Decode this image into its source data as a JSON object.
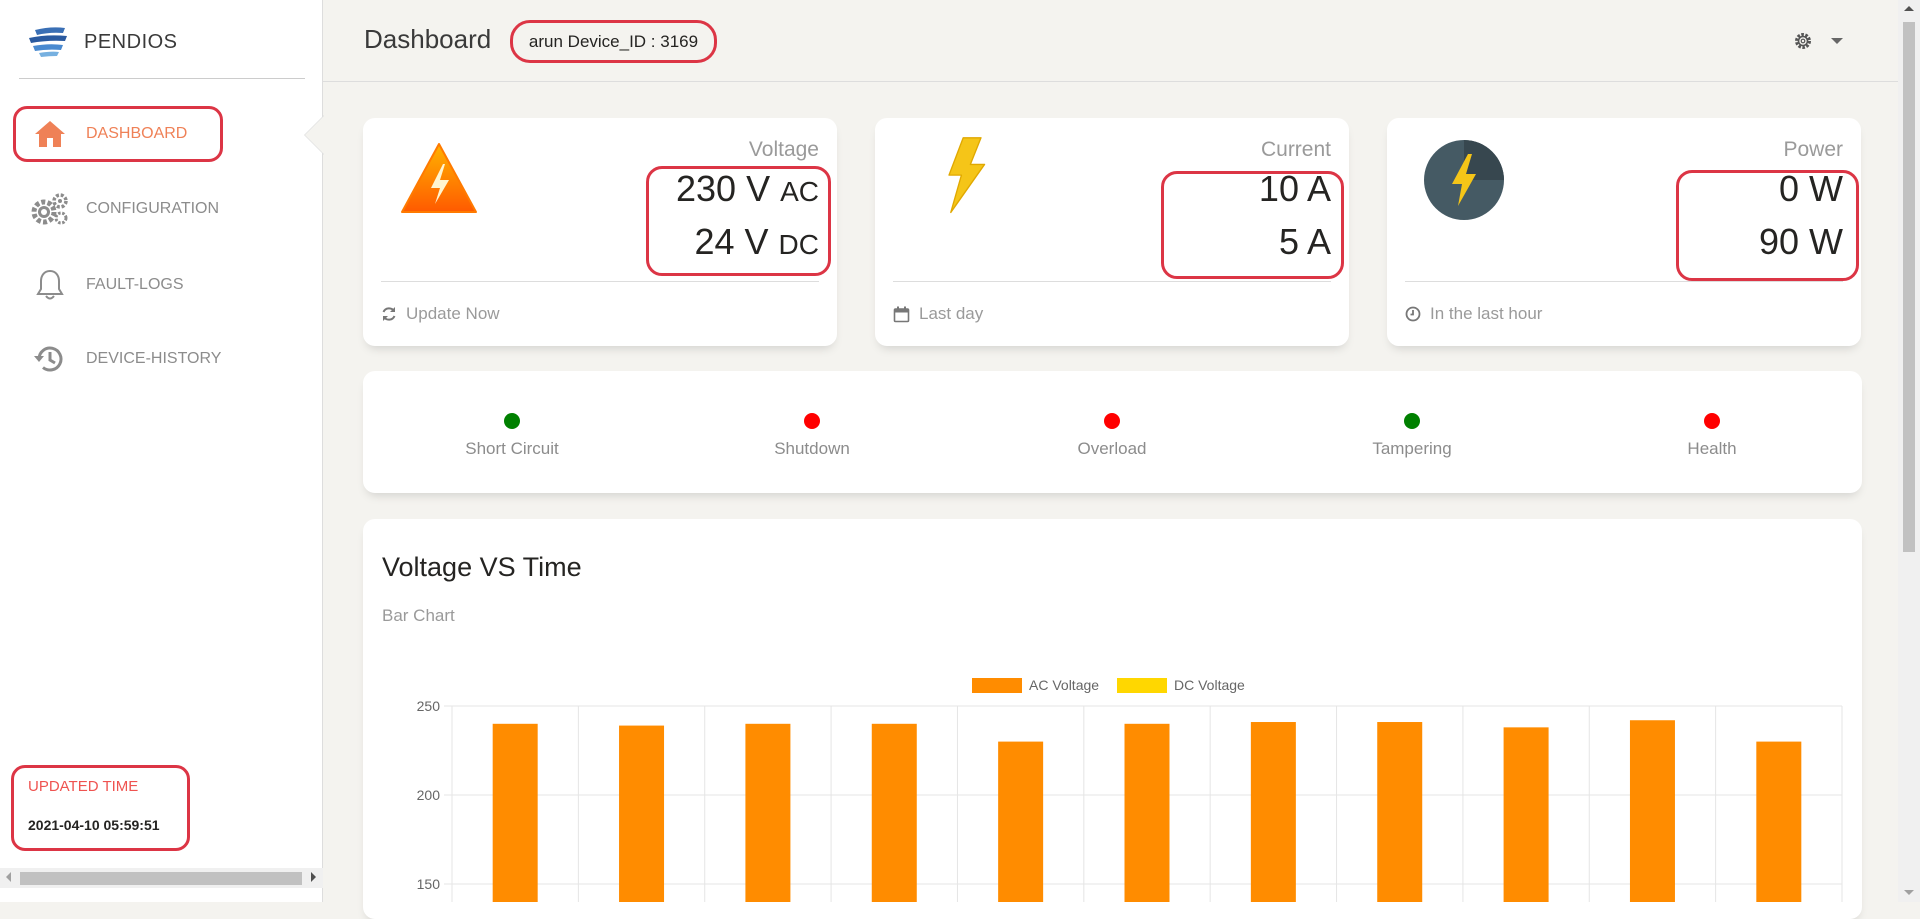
{
  "brand": {
    "name": "PENDIOS",
    "logo_icon": "pendios-logo-icon"
  },
  "sidebar": {
    "items": [
      {
        "label": "DASHBOARD",
        "icon": "home-icon",
        "active": true
      },
      {
        "label": "CONFIGURATION",
        "icon": "gears-icon",
        "active": false
      },
      {
        "label": "FAULT-LOGS",
        "icon": "bell-icon",
        "active": false
      },
      {
        "label": "DEVICE-HISTORY",
        "icon": "history-icon",
        "active": false
      }
    ],
    "updated_label": "UPDATED TIME",
    "updated_value": "2021-04-10 05:59:51"
  },
  "header": {
    "title": "Dashboard",
    "device": "arun Device_ID : 3169",
    "settings_icon": "gear-icon"
  },
  "stats": [
    {
      "title": "Voltage",
      "v1_num": "230 V",
      "v1_unit": "AC",
      "v2_num": "24 V",
      "v2_unit": "DC",
      "footer": "Update Now",
      "footer_icon": "refresh-icon",
      "icon": "warning-bolt-icon"
    },
    {
      "title": "Current",
      "v1_num": "10 A",
      "v1_unit": "",
      "v2_num": "5 A",
      "v2_unit": "",
      "footer": "Last day",
      "footer_icon": "calendar-icon",
      "icon": "lightning-bolt-icon"
    },
    {
      "title": "Power",
      "v1_num": "0 W",
      "v1_unit": "",
      "v2_num": "90 W",
      "v2_unit": "",
      "footer": "In the last hour",
      "footer_icon": "clock-icon",
      "icon": "power-circle-icon"
    }
  ],
  "status": [
    {
      "label": "Short Circuit",
      "color": "#008000"
    },
    {
      "label": "Shutdown",
      "color": "#ff0000"
    },
    {
      "label": "Overload",
      "color": "#ff0000"
    },
    {
      "label": "Tampering",
      "color": "#008000"
    },
    {
      "label": "Health",
      "color": "#ff0000"
    }
  ],
  "chart_card": {
    "title": "Voltage VS Time",
    "subtitle": "Bar Chart"
  },
  "colors": {
    "accent": "#ef8157",
    "highlight": "#dc3545",
    "ac_bar": "#ff8c00",
    "dc_bar": "#ffd700"
  },
  "chart_data": {
    "type": "bar",
    "title": "",
    "xlabel": "",
    "ylabel": "",
    "ylim": [
      150,
      250
    ],
    "yticks": [
      150,
      200,
      250
    ],
    "grid": true,
    "legend_position": "top-center",
    "series": [
      {
        "name": "AC Voltage",
        "color": "#ff8c00",
        "values": [
          240,
          239,
          240,
          240,
          230,
          240,
          241,
          241,
          238,
          242,
          230
        ]
      },
      {
        "name": "DC Voltage",
        "color": "#ffd700",
        "values": []
      }
    ]
  }
}
